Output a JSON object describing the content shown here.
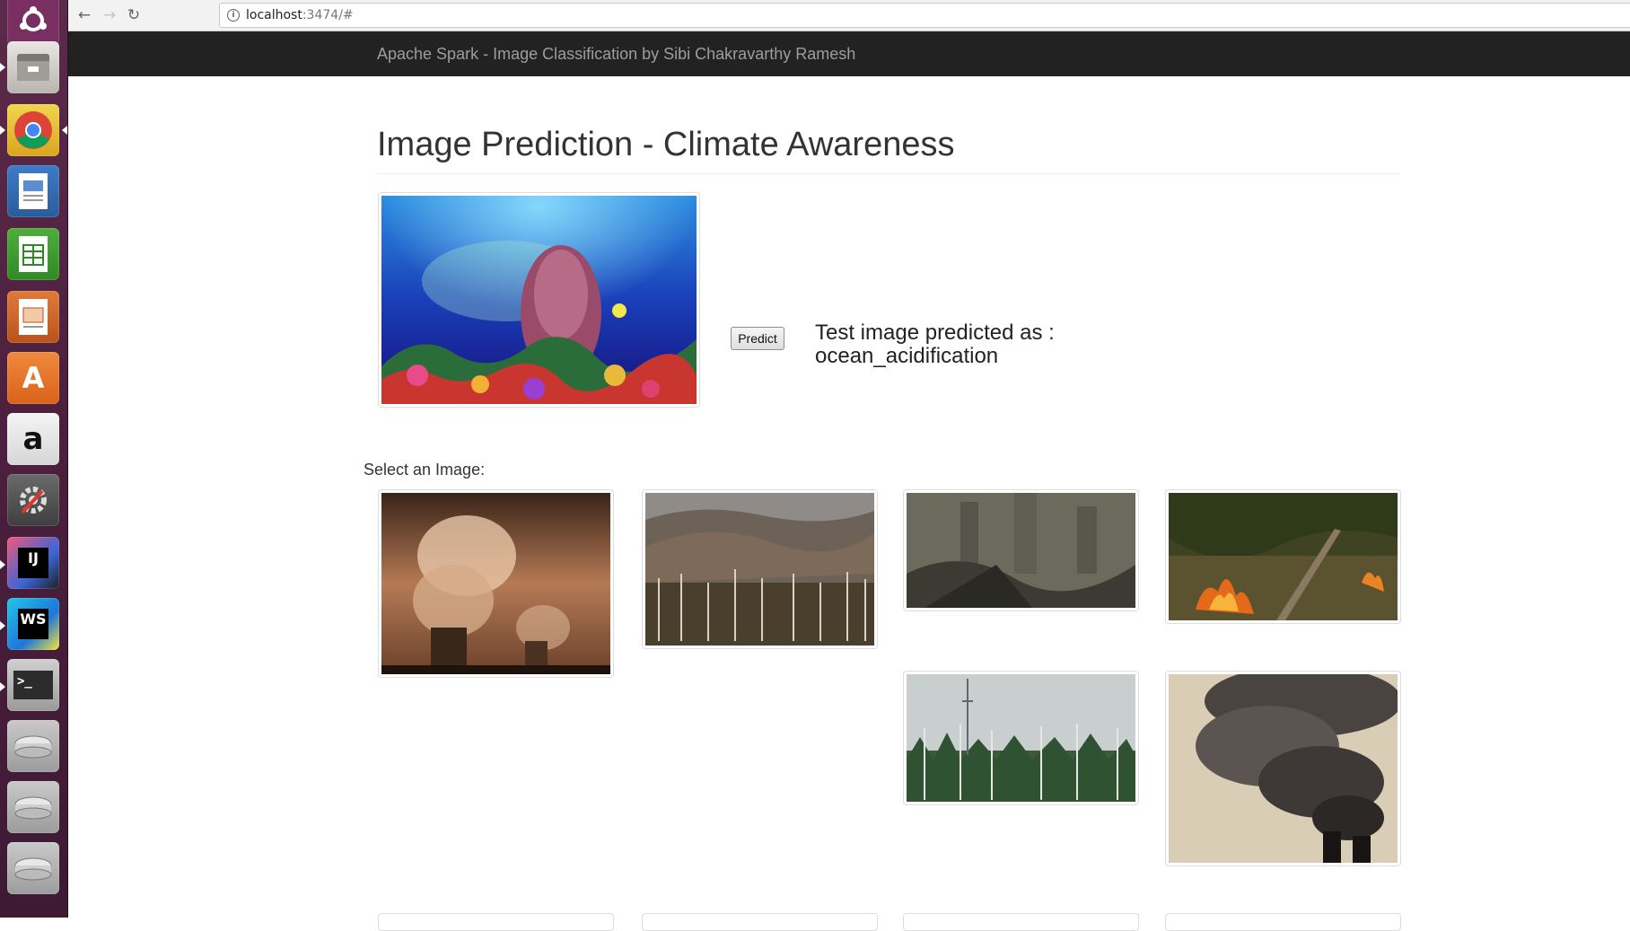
{
  "browser": {
    "url_host": "localhost",
    "url_rest": ":3474/#",
    "back_icon": "back-arrow-icon",
    "forward_icon": "forward-arrow-icon",
    "reload_icon": "reload-icon"
  },
  "navbar": {
    "brand": "Apache Spark - Image Classification by Sibi Chakravarthy Ramesh"
  },
  "main": {
    "title": "Image Prediction - Climate Awareness",
    "predict_label": "Predict",
    "prediction_line1": "Test image predicted as :",
    "prediction_line2": "ocean_acidification",
    "select_label": "Select an Image:"
  },
  "test_image": {
    "alt": "coral reef with fish"
  },
  "gallery": [
    {
      "alt": "power plant smoke clouds"
    },
    {
      "alt": "dead forest on mountains"
    },
    {
      "alt": "polluted city ruins"
    },
    {
      "alt": "forest fire"
    },
    {
      "alt": "dead trees and radio tower"
    },
    {
      "alt": "smokestacks emitting smoke"
    }
  ],
  "launcher": [
    {
      "name": "ubuntu-icon"
    },
    {
      "name": "files-icon"
    },
    {
      "name": "chrome-icon"
    },
    {
      "name": "writer-icon"
    },
    {
      "name": "calc-icon"
    },
    {
      "name": "impress-icon"
    },
    {
      "name": "software-center-icon"
    },
    {
      "name": "amazon-icon",
      "glyph": "a"
    },
    {
      "name": "system-settings-icon"
    },
    {
      "name": "intellij-icon",
      "glyph": "IJ"
    },
    {
      "name": "webstorm-icon",
      "glyph": "WS"
    },
    {
      "name": "terminal-icon",
      "glyph": ">_"
    },
    {
      "name": "drive-icon"
    },
    {
      "name": "drive-icon"
    },
    {
      "name": "drive-icon"
    }
  ],
  "colors": {
    "navbar_bg": "#222222",
    "brand_text": "#9d9d9d",
    "launcher_bg": "#4b1f3d"
  }
}
